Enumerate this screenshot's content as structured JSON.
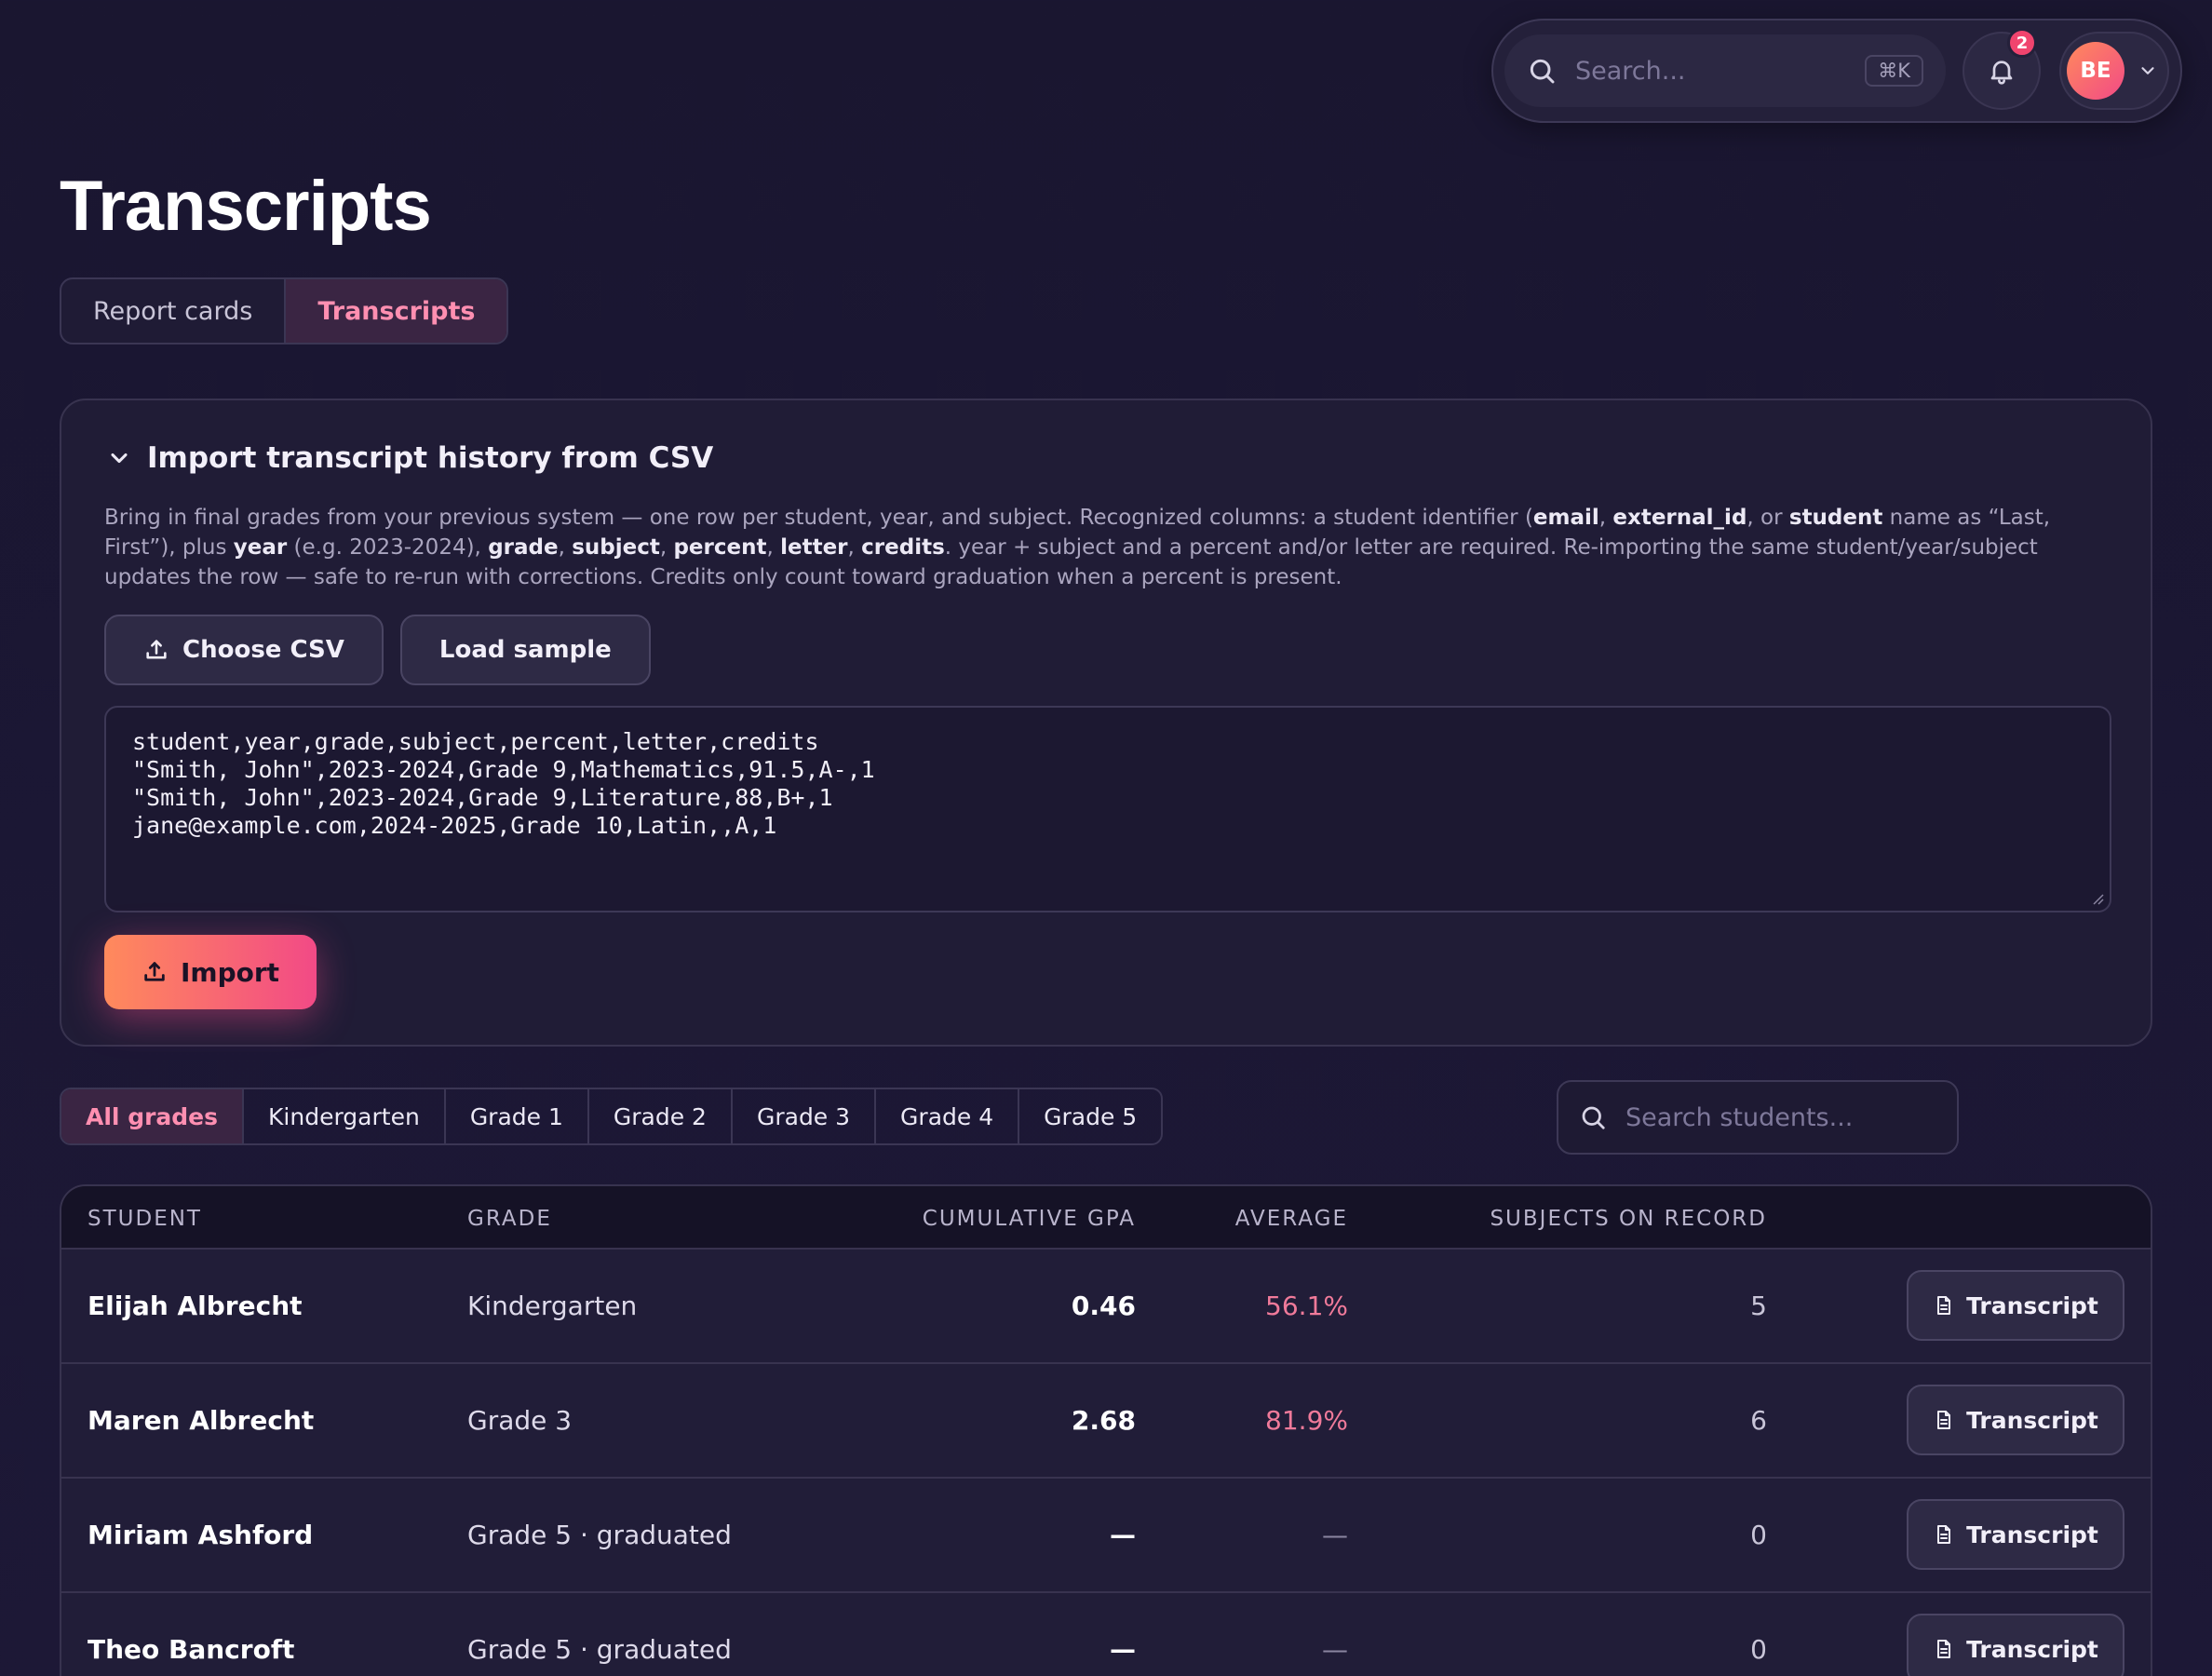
{
  "topbar": {
    "search_placeholder": "Search...",
    "shortcut": "⌘K",
    "notification_count": "2",
    "user_initials": "BE"
  },
  "page": {
    "title": "Transcripts",
    "tabs": [
      {
        "label": "Report cards",
        "active": false
      },
      {
        "label": "Transcripts",
        "active": true
      }
    ]
  },
  "import_card": {
    "title": "Import transcript history from CSV",
    "description_parts": [
      {
        "text": "Bring in final grades from your previous system — one row per student, year, and subject. Recognized columns: a student identifier (",
        "bold": false
      },
      {
        "text": "email",
        "bold": true
      },
      {
        "text": ", ",
        "bold": false
      },
      {
        "text": "external_id",
        "bold": true
      },
      {
        "text": ", or ",
        "bold": false
      },
      {
        "text": "student",
        "bold": true
      },
      {
        "text": " name as “Last, First”), plus ",
        "bold": false
      },
      {
        "text": "year",
        "bold": true
      },
      {
        "text": " (e.g. 2023-2024), ",
        "bold": false
      },
      {
        "text": "grade",
        "bold": true
      },
      {
        "text": ", ",
        "bold": false
      },
      {
        "text": "subject",
        "bold": true
      },
      {
        "text": ", ",
        "bold": false
      },
      {
        "text": "percent",
        "bold": true
      },
      {
        "text": ", ",
        "bold": false
      },
      {
        "text": "letter",
        "bold": true
      },
      {
        "text": ", ",
        "bold": false
      },
      {
        "text": "credits",
        "bold": true
      },
      {
        "text": ". year + subject and a percent and/or letter are required. Re-importing the same student/year/subject updates the row — safe to re-run with corrections. Credits only count toward graduation when a percent is present.",
        "bold": false
      }
    ],
    "choose_csv_label": "Choose CSV",
    "load_sample_label": "Load sample",
    "csv_text": "student,year,grade,subject,percent,letter,credits\n\"Smith, John\",2023-2024,Grade 9,Mathematics,91.5,A-,1\n\"Smith, John\",2023-2024,Grade 9,Literature,88,B+,1\njane@example.com,2024-2025,Grade 10,Latin,,A,1",
    "import_label": "Import"
  },
  "filters": {
    "options": [
      {
        "label": "All grades",
        "active": true
      },
      {
        "label": "Kindergarten",
        "active": false
      },
      {
        "label": "Grade 1",
        "active": false
      },
      {
        "label": "Grade 2",
        "active": false
      },
      {
        "label": "Grade 3",
        "active": false
      },
      {
        "label": "Grade 4",
        "active": false
      },
      {
        "label": "Grade 5",
        "active": false
      }
    ],
    "search_placeholder": "Search students..."
  },
  "table": {
    "headers": {
      "student": "STUDENT",
      "grade": "GRADE",
      "gpa": "CUMULATIVE GPA",
      "average": "AVERAGE",
      "subjects": "SUBJECTS ON RECORD"
    },
    "action_label": "Transcript",
    "rows": [
      {
        "student": "Elijah Albrecht",
        "grade": "Kindergarten",
        "gpa": "0.46",
        "average": "56.1%",
        "subjects": "5"
      },
      {
        "student": "Maren Albrecht",
        "grade": "Grade 3",
        "gpa": "2.68",
        "average": "81.9%",
        "subjects": "6"
      },
      {
        "student": "Miriam Ashford",
        "grade": "Grade 5 · graduated",
        "gpa": "—",
        "average": "—",
        "subjects": "0"
      },
      {
        "student": "Theo Bancroft",
        "grade": "Grade 5 · graduated",
        "gpa": "—",
        "average": "—",
        "subjects": "0"
      }
    ]
  },
  "colors": {
    "accent": "#f24a86",
    "accent_start": "#ff8a5c",
    "active_tab_text": "#ff8fb1",
    "average_text": "#f07a9a"
  }
}
